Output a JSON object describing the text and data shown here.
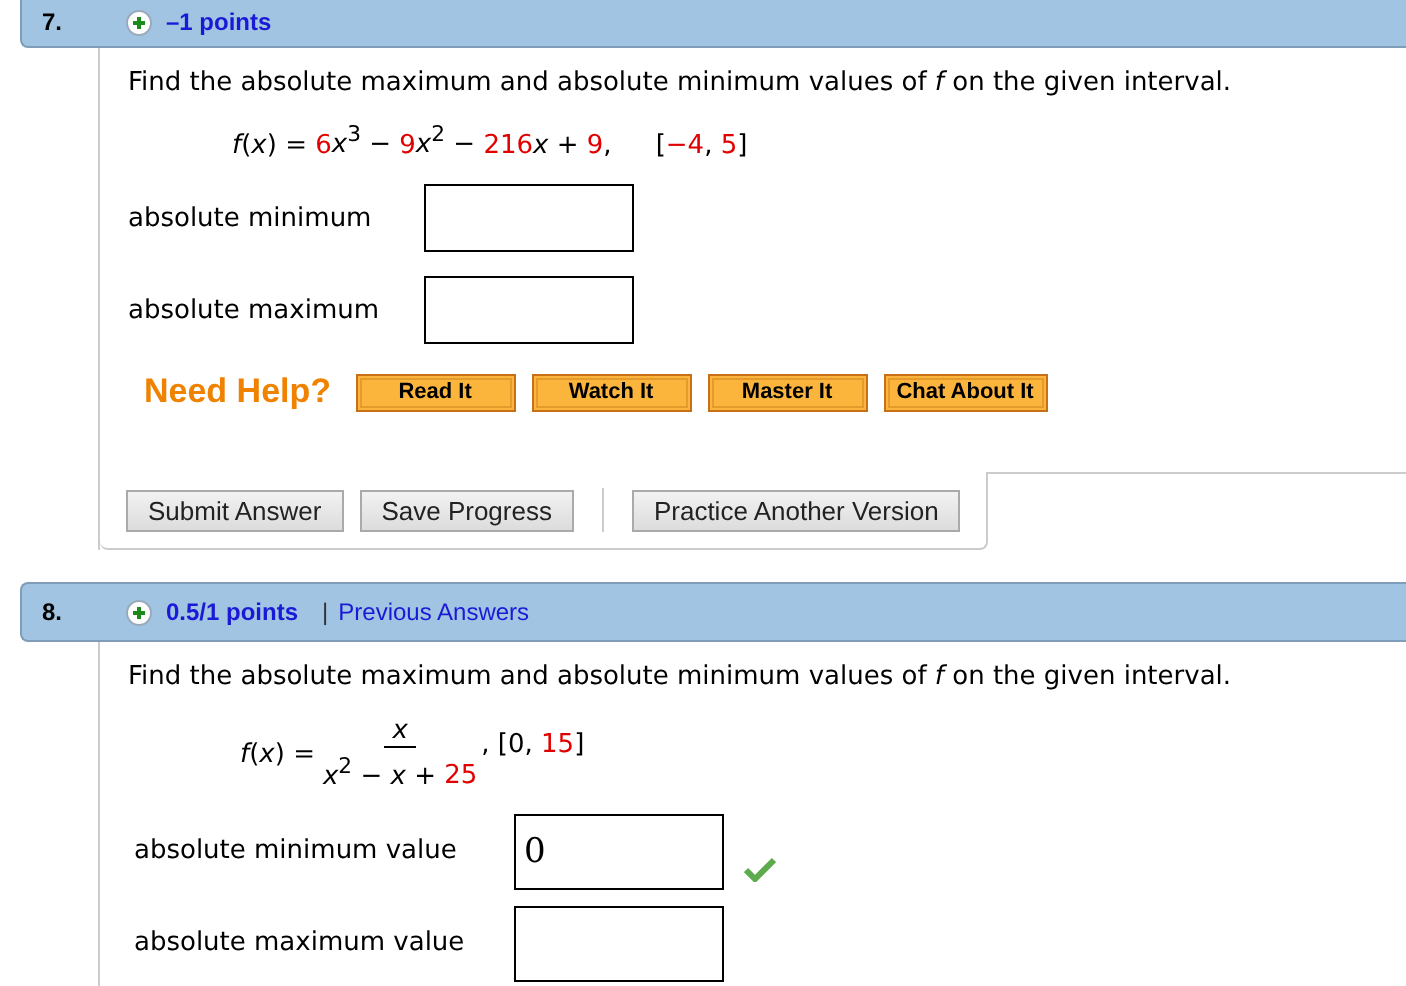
{
  "questions": [
    {
      "number": "7.",
      "points": "–1 points",
      "prompt": "Find the absolute maximum and absolute minimum values of *f* on the given interval.",
      "formula": {
        "kind": "poly",
        "lhs": "*f*(*x*) = ",
        "terms": [
          {
            "text": "6",
            "color": "#e00000"
          },
          {
            "text": "*x*$^{3}$ − ",
            "color": "#000000"
          },
          {
            "text": "9",
            "color": "#e00000"
          },
          {
            "text": "*x*$^{2}$ − ",
            "color": "#000000"
          },
          {
            "text": "216",
            "color": "#e00000"
          },
          {
            "text": "*x* + ",
            "color": "#000000"
          },
          {
            "text": "9",
            "color": "#e00000"
          },
          {
            "text": ",",
            "color": "#000000"
          }
        ],
        "interval": [
          {
            "text": "[",
            "color": "#000000"
          },
          {
            "text": "−4",
            "color": "#e00000"
          },
          {
            "text": ", ",
            "color": "#000000"
          },
          {
            "text": "5",
            "color": "#e00000"
          },
          {
            "text": "]",
            "color": "#000000"
          }
        ]
      },
      "answers": [
        {
          "label": "absolute minimum",
          "correct": false
        },
        {
          "label": "absolute maximum",
          "correct": false
        }
      ],
      "help": {
        "label": "Need Help?",
        "buttons": [
          "Read It",
          "Watch It",
          "Master It",
          "Chat About It"
        ]
      },
      "actions": [
        "Submit Answer",
        "Save Progress"
      ],
      "extra_action": "Practice Another Version"
    },
    {
      "number": "8.",
      "points": "0.5/1 points",
      "separator": "|",
      "previous_answers": "Previous Answers",
      "prompt": "Find the absolute maximum and absolute minimum values of *f* on the given interval.",
      "formula": {
        "kind": "fraction",
        "lhs": "*f*(*x*) = ",
        "numerator": [
          {
            "text": "*x*",
            "color": "#000000"
          }
        ],
        "denominator": [
          {
            "text": "*x*$^{2}$ − *x* + ",
            "color": "#000000"
          },
          {
            "text": "25",
            "color": "#e00000"
          }
        ],
        "interval": [
          {
            "text": ",  [0, ",
            "color": "#000000"
          },
          {
            "text": "15",
            "color": "#e00000"
          },
          {
            "text": "]",
            "color": "#000000"
          }
        ]
      },
      "answers": [
        {
          "label": "absolute minimum value",
          "value": "0",
          "correct": true
        },
        {
          "label": "absolute maximum value",
          "correct": false
        }
      ]
    }
  ]
}
